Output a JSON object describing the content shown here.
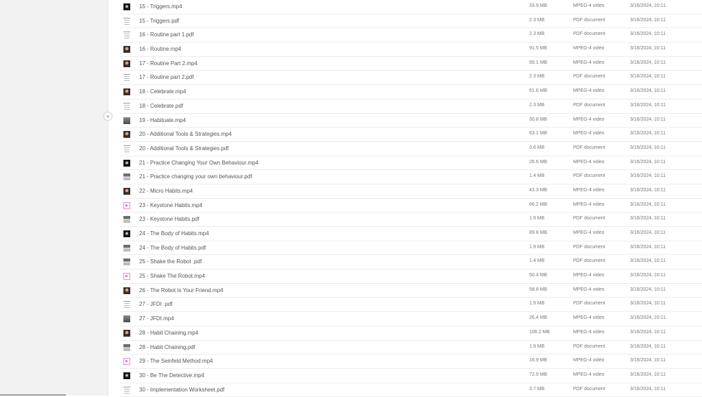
{
  "sidebar": {
    "toggle_label": "«"
  },
  "files": [
    {
      "name": "15 - Triggers.mp4",
      "size": "33.9 MB",
      "type": "MPEG-4 video",
      "modified": "3/16/2024, 10:11",
      "thumb": "vid dark"
    },
    {
      "name": "15 - Triggers.pdf",
      "size": "2.3 MB",
      "type": "PDF document",
      "modified": "3/16/2024, 10:11",
      "thumb": "pdf"
    },
    {
      "name": "16 - Routine part 1.pdf",
      "size": "2.3 MB",
      "type": "PDF document",
      "modified": "3/16/2024, 10:11",
      "thumb": "pdf"
    },
    {
      "name": "16 - Routine.mp4",
      "size": "91.5 MB",
      "type": "MPEG-4 video",
      "modified": "3/16/2024, 10:11",
      "thumb": "vid"
    },
    {
      "name": "17 - Routine Part 2.mp4",
      "size": "89.1 MB",
      "type": "MPEG-4 video",
      "modified": "3/16/2024, 10:11",
      "thumb": "vid"
    },
    {
      "name": "17 - Routine part 2.pdf",
      "size": "2.3 MB",
      "type": "PDF document",
      "modified": "3/16/2024, 10:11",
      "thumb": "pdf"
    },
    {
      "name": "18 - Celebrate.mp4",
      "size": "61.6 MB",
      "type": "MPEG-4 video",
      "modified": "3/16/2024, 10:11",
      "thumb": "vid"
    },
    {
      "name": "18 - Celebrate.pdf",
      "size": "2.3 MB",
      "type": "PDF document",
      "modified": "3/16/2024, 10:11",
      "thumb": "pdf"
    },
    {
      "name": "19 - Habituate.mp4",
      "size": "30.8 MB",
      "type": "MPEG-4 video",
      "modified": "3/16/2024, 10:11",
      "thumb": "vid grey"
    },
    {
      "name": "20 - Additional Tools & Strategies.mp4",
      "size": "63.1 MB",
      "type": "MPEG-4 video",
      "modified": "3/16/2024, 10:11",
      "thumb": "vid"
    },
    {
      "name": "20 - Additional Tools & Strategies.pdf",
      "size": "3.6 MB",
      "type": "PDF document",
      "modified": "3/16/2024, 10:11",
      "thumb": "pdf"
    },
    {
      "name": "21 - Practice Changing Your Own Behaviour.mp4",
      "size": "26.6 MB",
      "type": "MPEG-4 video",
      "modified": "3/16/2024, 10:11",
      "thumb": "vid dark"
    },
    {
      "name": "21 - Practice changing your own behaviour.pdf",
      "size": "1.4 MB",
      "type": "PDF document",
      "modified": "3/16/2024, 10:11",
      "thumb": "pdf-img"
    },
    {
      "name": "22 - Micro Habits.mp4",
      "size": "43.3 MB",
      "type": "MPEG-4 video",
      "modified": "3/16/2024, 10:11",
      "thumb": "vid"
    },
    {
      "name": "23 - Keystone Habits.mp4",
      "size": "66.2 MB",
      "type": "MPEG-4 video",
      "modified": "3/16/2024, 10:11",
      "thumb": "vid play"
    },
    {
      "name": "23 - Keystone Habits.pdf",
      "size": "1.9 MB",
      "type": "PDF document",
      "modified": "3/16/2024, 10:11",
      "thumb": "pdf-img"
    },
    {
      "name": "24 - The Body of Habits.mp4",
      "size": "89.8 MB",
      "type": "MPEG-4 video",
      "modified": "3/16/2024, 10:11",
      "thumb": "vid dark"
    },
    {
      "name": "24 - The Body of Habits.pdf",
      "size": "1.9 MB",
      "type": "PDF document",
      "modified": "3/16/2024, 10:11",
      "thumb": "pdf-img"
    },
    {
      "name": "25 - Shake the Robot .pdf",
      "size": "1.4 MB",
      "type": "PDF document",
      "modified": "3/16/2024, 10:11",
      "thumb": "pdf-img"
    },
    {
      "name": "25 - Shake The Robot.mp4",
      "size": "50.4 MB",
      "type": "MPEG-4 video",
      "modified": "3/16/2024, 10:11",
      "thumb": "vid play"
    },
    {
      "name": "26 - The Robot Is Your Friend.mp4",
      "size": "58.8 MB",
      "type": "MPEG-4 video",
      "modified": "3/16/2024, 10:11",
      "thumb": "vid"
    },
    {
      "name": "27 - JFDI .pdf",
      "size": "1.9 MB",
      "type": "PDF document",
      "modified": "3/16/2024, 10:11",
      "thumb": "pdf"
    },
    {
      "name": "27 - JFDI.mp4",
      "size": "26.4 MB",
      "type": "MPEG-4 video",
      "modified": "3/16/2024, 10:11",
      "thumb": "vid grey"
    },
    {
      "name": "28 - Habit Chaining.mp4",
      "size": "106.2 MB",
      "type": "MPEG-4 video",
      "modified": "3/16/2024, 10:11",
      "thumb": "vid"
    },
    {
      "name": "28 - Habit Chaining.pdf",
      "size": "1.9 MB",
      "type": "PDF document",
      "modified": "3/16/2024, 10:11",
      "thumb": "pdf-img"
    },
    {
      "name": "29 - The Seinfeld Method.mp4",
      "size": "16.9 MB",
      "type": "MPEG-4 video",
      "modified": "3/16/2024, 10:11",
      "thumb": "vid play"
    },
    {
      "name": "30 - Be The Detective.mp4",
      "size": "72.9 MB",
      "type": "MPEG-4 video",
      "modified": "3/16/2024, 10:11",
      "thumb": "vid dark"
    },
    {
      "name": "30 - Implementation Worksheet.pdf",
      "size": "3.7 MB",
      "type": "PDF document",
      "modified": "3/16/2024, 10:11",
      "thumb": "pdf"
    }
  ]
}
